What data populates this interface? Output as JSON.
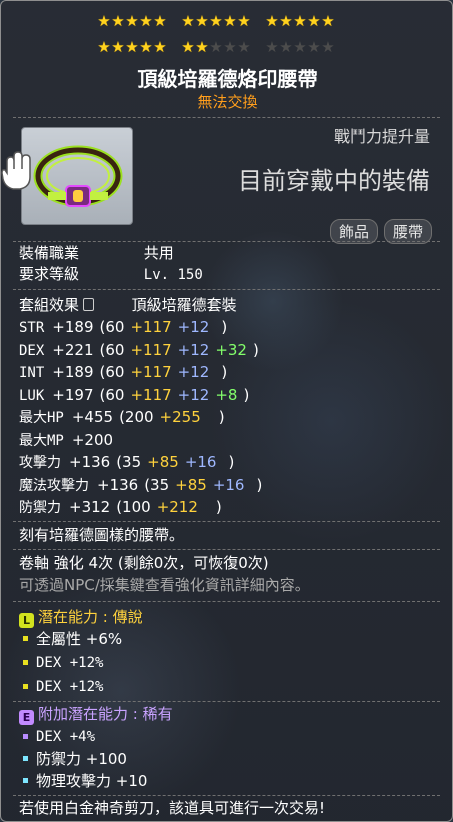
{
  "stars": {
    "groups": [
      [
        true,
        true,
        true,
        true,
        true
      ],
      [
        true,
        true,
        true,
        true,
        true
      ],
      [
        true,
        true,
        true,
        true,
        true
      ],
      [
        true,
        true,
        true,
        true,
        true
      ],
      [
        true,
        true,
        false,
        false,
        false
      ],
      [
        false,
        false,
        false,
        false,
        false
      ]
    ]
  },
  "item": {
    "name": "頂級培羅德烙印腰帶",
    "trade": "無法交換",
    "power_label": "戰鬥力提升量",
    "equipped_text": "目前穿戴中的裝備",
    "tags": [
      "飾品",
      "腰帶"
    ]
  },
  "reqs": {
    "job_label": "裝備職業",
    "job_value": "共用",
    "level_label": "要求等級",
    "level_value": "Lv. 150"
  },
  "set": {
    "label": "套組效果",
    "name": "頂級培羅德套裝"
  },
  "stats": [
    {
      "name": "STR",
      "total": "+189",
      "base": "(60",
      "yellow": "+117",
      "blue": "+12",
      "green": "",
      "close": ")"
    },
    {
      "name": "DEX",
      "total": "+221",
      "base": "(60",
      "yellow": "+117",
      "blue": "+12",
      "green": "+32",
      "close": ")"
    },
    {
      "name": "INT",
      "total": "+189",
      "base": "(60",
      "yellow": "+117",
      "blue": "+12",
      "green": "",
      "close": ")"
    },
    {
      "name": "LUK",
      "total": "+197",
      "base": "(60",
      "yellow": "+117",
      "blue": "+12",
      "green": "+8",
      "close": ")"
    },
    {
      "name": "最大HP",
      "total": "+455",
      "base": "(200",
      "yellow": "+255",
      "blue": "",
      "green": "",
      "close": ")"
    },
    {
      "name": "最大MP",
      "total": "+200",
      "base": "",
      "yellow": "",
      "blue": "",
      "green": "",
      "close": ""
    },
    {
      "name": "攻擊力",
      "total": "+136",
      "base": "(35",
      "yellow": "+85",
      "blue": "+16",
      "green": "",
      "close": ")"
    },
    {
      "name": "魔法攻擊力",
      "total": "+136",
      "base": "(35",
      "yellow": "+85",
      "blue": "+16",
      "green": "",
      "close": ")"
    },
    {
      "name": "防禦力",
      "total": "+312",
      "base": "(100",
      "yellow": "+212",
      "blue": "",
      "green": "",
      "close": ")"
    }
  ],
  "desc": "刻有培羅德圖樣的腰帶。",
  "upgrade": {
    "line": "卷軸 強化 4次 (剩餘0次，可恢復0次)",
    "note": "可透過NPC/採集鍵查看強化資訊詳細內容。"
  },
  "potential": {
    "icon": "L",
    "title": "潛在能力 : 傳說",
    "lines": [
      "全屬性 +6%",
      "DEX +12%",
      "DEX +12%"
    ]
  },
  "bonus": {
    "icon": "E",
    "title": "附加潛在能力 : 稀有",
    "lines": [
      "DEX +4%",
      "防禦力 +100",
      "物理攻擊力 +10"
    ]
  },
  "footer": "若使用白金神奇剪刀，該道具可進行一次交易!",
  "colors": {
    "yellow": "#ffd23d",
    "blue": "#9fb8ff",
    "green": "#83ff6b",
    "orange": "#ff9e1c"
  }
}
